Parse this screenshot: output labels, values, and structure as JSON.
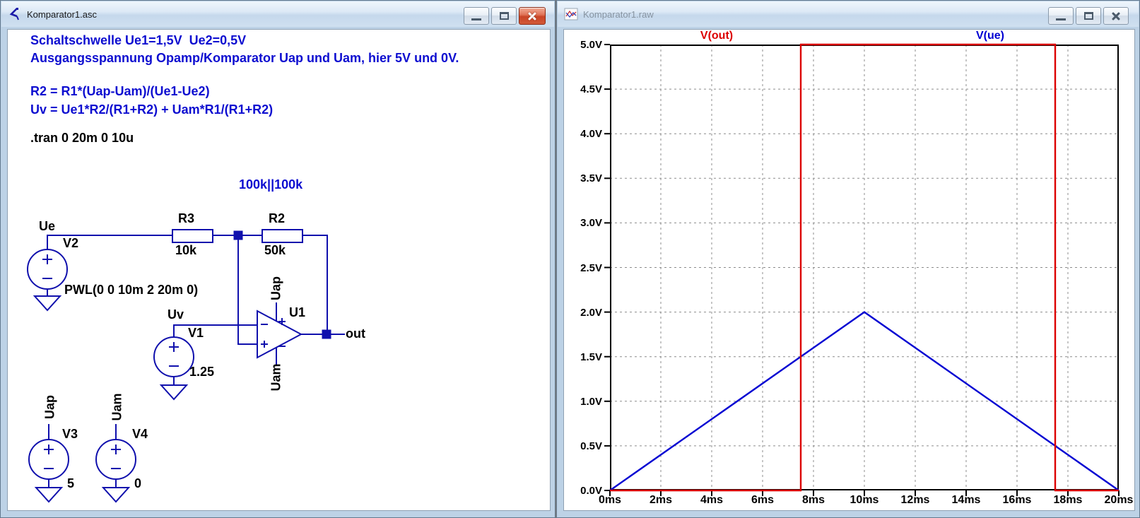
{
  "colors": {
    "wire": "#1010ad",
    "comment_text": "#0d0dd0",
    "trace_out": "#dc0000",
    "trace_ue": "#0000d2",
    "grid": "#8c8c8c",
    "active_close_button": "#cf4a2e"
  },
  "windows": {
    "schematic": {
      "title": "Komparator1.asc"
    },
    "waveform": {
      "title": "Komparator1.raw"
    }
  },
  "schematic": {
    "comment1": "Schaltschwelle Ue1=1,5V  Ue2=0,5V",
    "comment2": "Ausgangsspannung Opamp/Komparator Uap und Uam, hier 5V und 0V.",
    "formula1": "R2 = R1*(Uap-Uam)/(Ue1-Ue2)",
    "formula2": "Uv = Ue1*R2/(R1+R2) + Uam*R1/(R1+R2)",
    "directive": ".tran 0 20m 0 10u",
    "parallel_note": "100k||100k",
    "net_ue": "Ue",
    "net_uv": "Uv",
    "net_out": "out",
    "r3_name": "R3",
    "r3_value": "10k",
    "r2_name": "R2",
    "r2_value": "50k",
    "v2_name": "V2",
    "v2_value": "PWL(0 0 10m 2 20m 0)",
    "v1_name": "V1",
    "v1_value": "1.25",
    "u1_name": "U1",
    "u1_rail_top": "Uap",
    "u1_rail_bottom": "Uam",
    "v3_net": "Uap",
    "v3_name": "V3",
    "v3_value": "5",
    "v4_net": "Uam",
    "v4_name": "V4",
    "v4_value": "0"
  },
  "chart_data": {
    "type": "line",
    "xlim": [
      0,
      20
    ],
    "ylim": [
      0,
      5
    ],
    "x_ticks": [
      0,
      2,
      4,
      6,
      8,
      10,
      12,
      14,
      16,
      18,
      20
    ],
    "x_tick_labels": [
      "0ms",
      "2ms",
      "4ms",
      "6ms",
      "8ms",
      "10ms",
      "12ms",
      "14ms",
      "16ms",
      "18ms",
      "20ms"
    ],
    "y_ticks": [
      0,
      0.5,
      1,
      1.5,
      2,
      2.5,
      3,
      3.5,
      4,
      4.5,
      5
    ],
    "y_tick_labels": [
      "0.0V",
      "0.5V",
      "1.0V",
      "1.5V",
      "2.0V",
      "2.5V",
      "3.0V",
      "3.5V",
      "4.0V",
      "4.5V",
      "5.0V"
    ],
    "grid": true,
    "legend_position": "top",
    "series": [
      {
        "name": "V(out)",
        "color": "#dc0000",
        "points": [
          [
            0,
            0
          ],
          [
            7.5,
            0
          ],
          [
            7.5,
            5
          ],
          [
            17.5,
            5
          ],
          [
            17.5,
            0
          ],
          [
            20,
            0
          ]
        ]
      },
      {
        "name": "V(ue)",
        "color": "#0000d2",
        "points": [
          [
            0,
            0
          ],
          [
            10,
            2
          ],
          [
            20,
            0
          ]
        ]
      }
    ]
  }
}
